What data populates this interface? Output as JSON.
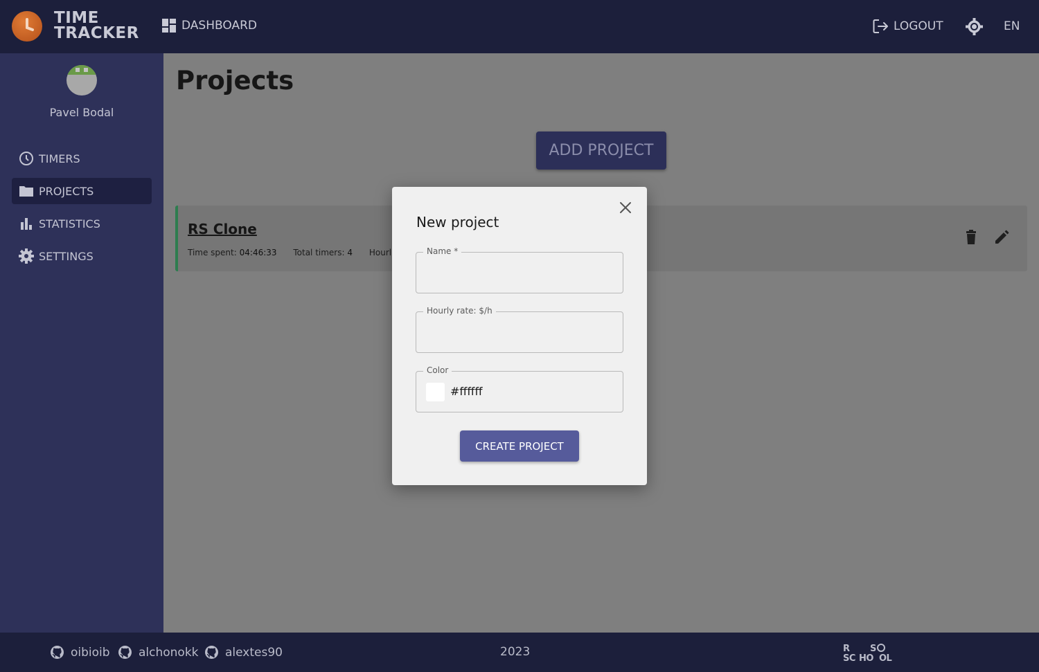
{
  "app": {
    "logo_line1": "TIME",
    "logo_line2": "TRACKER"
  },
  "header": {
    "dashboard_label": "DASHBOARD",
    "logout_label": "LOGOUT",
    "language": "EN"
  },
  "sidebar": {
    "username": "Pavel Bodal",
    "items": [
      {
        "label": "TIMERS",
        "icon": "clock-icon",
        "active": false
      },
      {
        "label": "PROJECTS",
        "icon": "folder-icon",
        "active": true
      },
      {
        "label": "STATISTICS",
        "icon": "bar-chart-icon",
        "active": false
      },
      {
        "label": "SETTINGS",
        "icon": "gear-icon",
        "active": false
      }
    ]
  },
  "main": {
    "title": "Projects",
    "add_button": "ADD PROJECT",
    "projects": [
      {
        "name": "RS Clone",
        "time_spent_label": "Time spent:",
        "time_spent": "04:46:33",
        "total_timers_label": "Total timers:",
        "total_timers": "4",
        "hourly_label_partial": "Hourl",
        "accent_color": "#2e7d4f"
      }
    ]
  },
  "modal": {
    "title": "New project",
    "name_label": "Name *",
    "name_value": "",
    "rate_label": "Hourly rate: $/h",
    "rate_value": "",
    "color_label": "Color",
    "color_value": "#ffffff",
    "submit_label": "CREATE PROJECT"
  },
  "footer": {
    "authors": [
      "oibioib",
      "alchonokk",
      "alextes90"
    ],
    "year": "2023",
    "school_logo": "RS School"
  },
  "colors": {
    "header_bg": "#1c1f3b",
    "sidebar_bg": "#2e3159",
    "primary_button": "#565b9b",
    "overlay": "#7f7f7f"
  }
}
